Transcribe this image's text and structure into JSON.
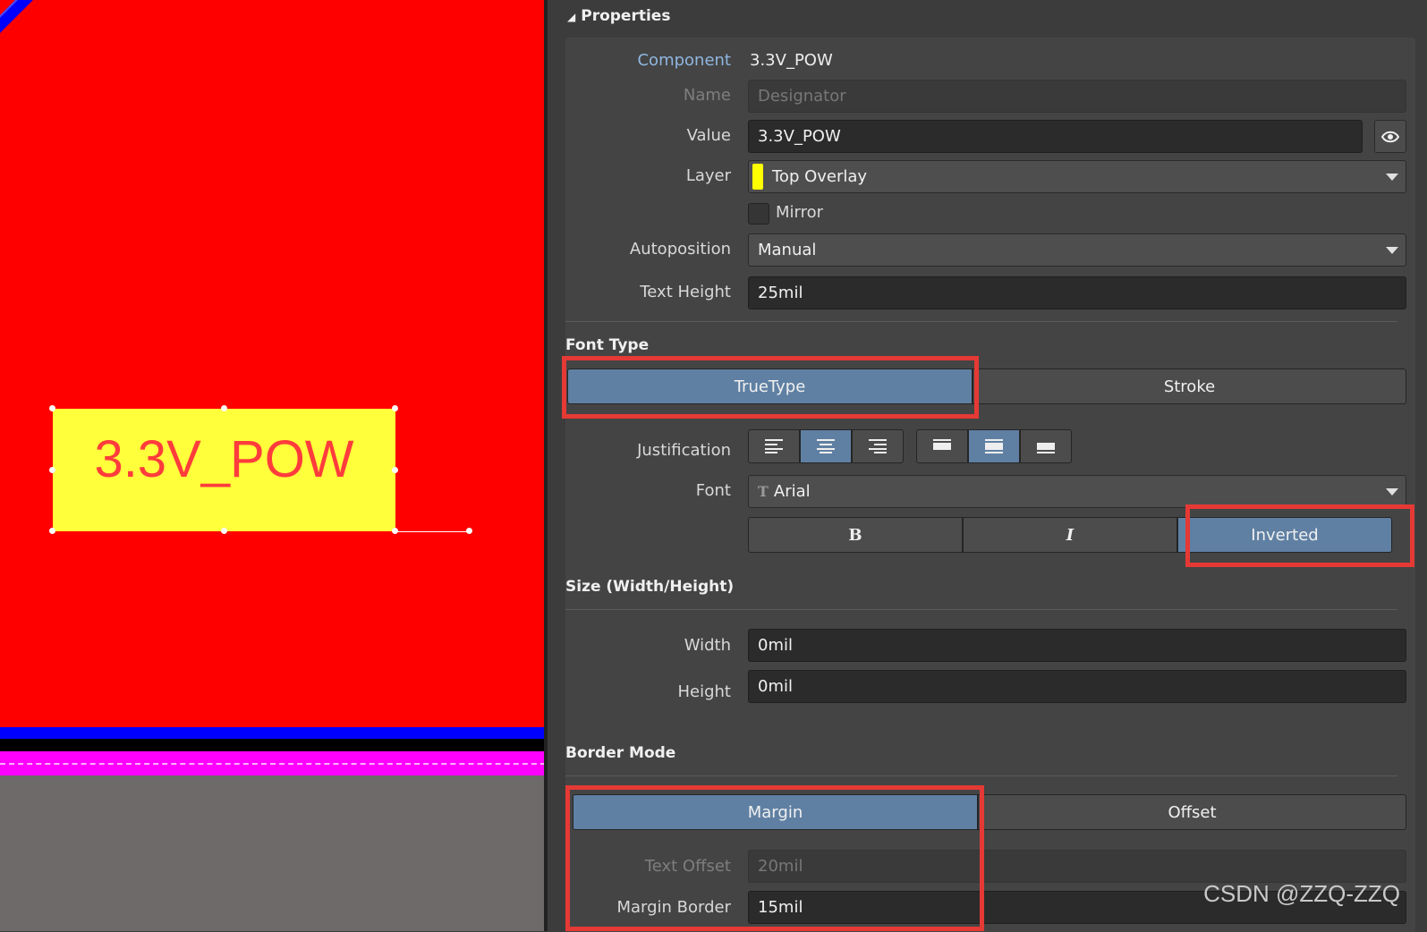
{
  "canvas": {
    "component_text": "3.3V_POW"
  },
  "panel": {
    "title": "Properties",
    "component_label": "Component",
    "component_value": "3.3V_POW",
    "name_label": "Name",
    "name_placeholder": "Designator",
    "value_label": "Value",
    "value_value": "3.3V_POW",
    "layer_label": "Layer",
    "layer_value": "Top Overlay",
    "layer_color": "#ffff00",
    "mirror_label": "Mirror",
    "mirror_checked": false,
    "autoposition_label": "Autoposition",
    "autoposition_value": "Manual",
    "text_height_label": "Text Height",
    "text_height_value": "25mil"
  },
  "font_type": {
    "section": "Font Type",
    "truetype_label": "TrueType",
    "stroke_label": "Stroke",
    "selected": "TrueType",
    "justification_label": "Justification",
    "font_label": "Font",
    "font_value": "Arial",
    "bold_label": "B",
    "italic_label": "I",
    "inverted_label": "Inverted"
  },
  "size": {
    "section": "Size (Width/Height)",
    "width_label": "Width",
    "width_value": "0mil",
    "height_label": "Height",
    "height_value": "0mil"
  },
  "border": {
    "section": "Border Mode",
    "margin_label": "Margin",
    "offset_label": "Offset",
    "selected": "Margin",
    "text_offset_label": "Text Offset",
    "text_offset_value": "20mil",
    "margin_border_label": "Margin Border",
    "margin_border_value": "15mil"
  },
  "watermark": "CSDN @ZZQ-ZZQ",
  "colors": {
    "canvas_red": "#ff0000",
    "text_fill": "#ffff3c",
    "text_color": "#ff3c3c",
    "active_segment": "#5f80a3",
    "highlight_box": "#e53935"
  }
}
